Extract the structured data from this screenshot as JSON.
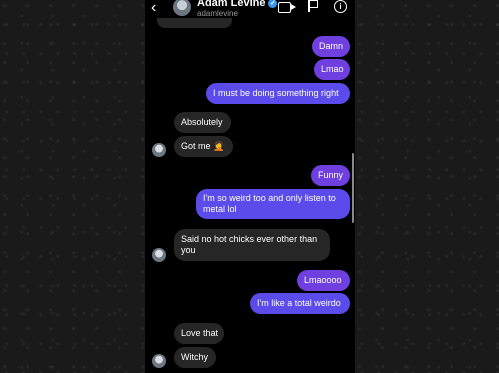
{
  "header": {
    "back_icon": "chevron-left-icon",
    "name": "Adam Levine",
    "handle": "adamlevine",
    "verified_mark": "✓",
    "info_glyph": "i"
  },
  "messages": [
    {
      "side": "sent",
      "text": "Damn"
    },
    {
      "side": "sent",
      "text": "Lmao"
    },
    {
      "side": "sent",
      "text": "I must be doing something right"
    },
    {
      "side": "received",
      "text": "Absolutely"
    },
    {
      "side": "received",
      "text": "Got me 🤦"
    },
    {
      "side": "sent",
      "text": "Funny"
    },
    {
      "side": "sent",
      "text": "I'm so weird too and only listen to"
    },
    {
      "side": "sent",
      "text": "metal lol"
    },
    {
      "side": "received",
      "text": "Said no hot chicks ever other than"
    },
    {
      "side": "received",
      "text": "you"
    },
    {
      "side": "sent",
      "text": "Lmaoooo"
    },
    {
      "side": "sent",
      "text": "I'm like a total weirdo"
    },
    {
      "side": "received",
      "text": "Love that"
    },
    {
      "side": "received",
      "text": "Witchy"
    }
  ],
  "colors": {
    "sent_top": "#6f3fe0",
    "sent_bottom": "#5a4bea",
    "received": "#262626"
  }
}
